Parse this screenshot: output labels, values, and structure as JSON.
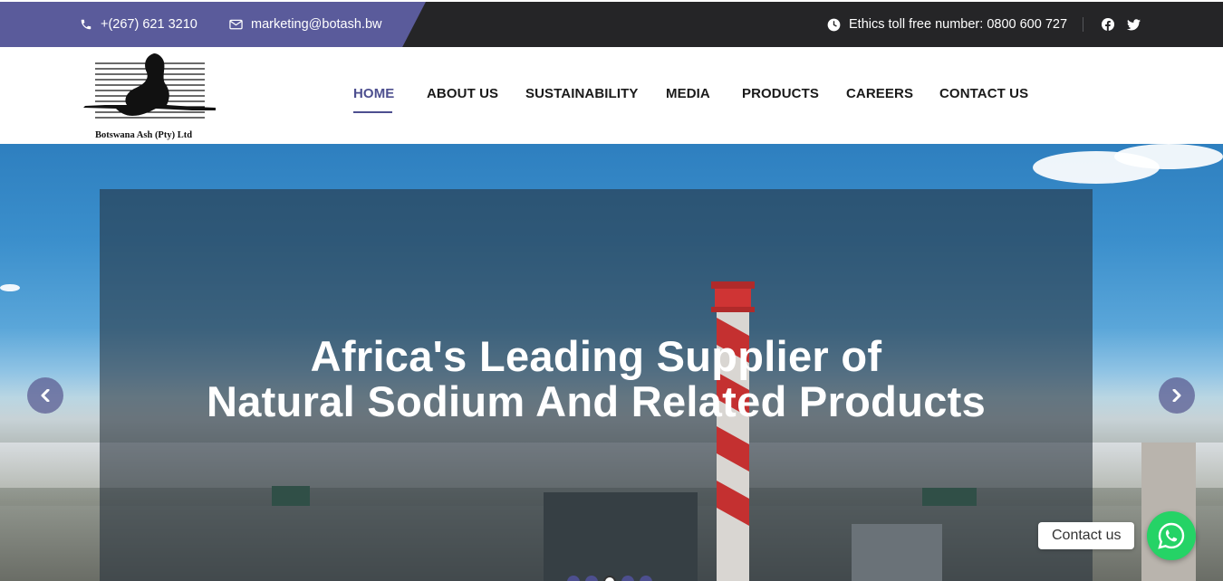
{
  "topbar": {
    "phone": "+(267) 621 3210",
    "email": "marketing@botash.bw",
    "ethics": "Ethics toll free number: 0800 600 727",
    "accent_color": "#5a5b9b",
    "bg_color": "#252527",
    "social": [
      "facebook-icon",
      "twitter-icon"
    ]
  },
  "logo": {
    "text": "Botswana Ash (Pty) Ltd"
  },
  "nav": {
    "items": [
      {
        "label": "HOME",
        "active": true
      },
      {
        "label": "ABOUT US"
      },
      {
        "label": "SUSTAINABILITY"
      },
      {
        "label": "MEDIA"
      },
      {
        "label": "PRODUCTS"
      },
      {
        "label": "CAREERS"
      },
      {
        "label": "CONTACT US"
      }
    ],
    "active_color": "#4d4f8f"
  },
  "hero": {
    "title_line1": "Africa's Leading Supplier of",
    "title_line2": "Natural Sodium And Related Products",
    "slides_count": 5,
    "active_slide": 3
  },
  "contact_widget": {
    "label": "Contact us",
    "icon": "whatsapp-icon",
    "color": "#25d366"
  }
}
